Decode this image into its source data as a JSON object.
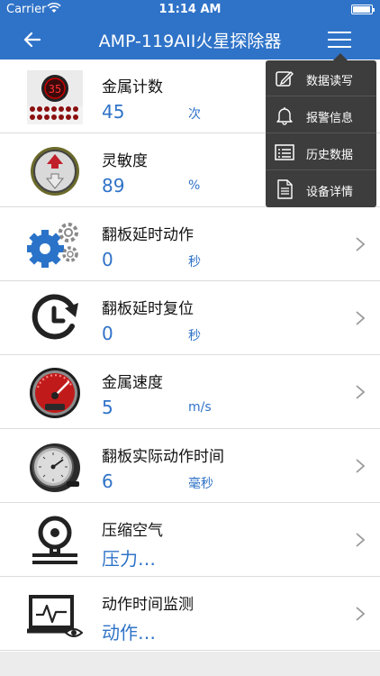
{
  "statusbar": {
    "carrier": "Carrier",
    "time": "11:14 AM"
  },
  "navbar": {
    "title": "AMP-119AII火星探除器"
  },
  "rows": [
    {
      "label": "金属计数",
      "value": "45",
      "unit": "次",
      "icon": "metal-counter-icon",
      "counter_display": "35"
    },
    {
      "label": "灵敏度",
      "value": "89",
      "unit": "%",
      "icon": "sensitivity-icon"
    },
    {
      "label": "翻板延时动作",
      "value": "0",
      "unit": "秒",
      "icon": "gears-icon"
    },
    {
      "label": "翻板延时复位",
      "value": "0",
      "unit": "秒",
      "icon": "clock-reset-icon"
    },
    {
      "label": "金属速度",
      "value": "5",
      "unit": "m/s",
      "icon": "speedometer-icon"
    },
    {
      "label": "翻板实际动作时间",
      "value": "6",
      "unit": "毫秒",
      "icon": "gauge-icon"
    },
    {
      "label": "压缩空气",
      "value": "压力…",
      "unit": "",
      "icon": "pressure-gauge-icon"
    },
    {
      "label": "动作时间监测",
      "value": "动作…",
      "unit": "",
      "icon": "monitor-icon"
    }
  ],
  "dropdown": {
    "items": [
      {
        "label": "数据读写",
        "icon": "edit-icon"
      },
      {
        "label": "报警信息",
        "icon": "bell-icon"
      },
      {
        "label": "历史数据",
        "icon": "list-icon"
      },
      {
        "label": "设备详情",
        "icon": "document-icon"
      }
    ]
  },
  "colors": {
    "accent": "#2f73c8",
    "dropdown_bg": "#3d3d3d"
  }
}
